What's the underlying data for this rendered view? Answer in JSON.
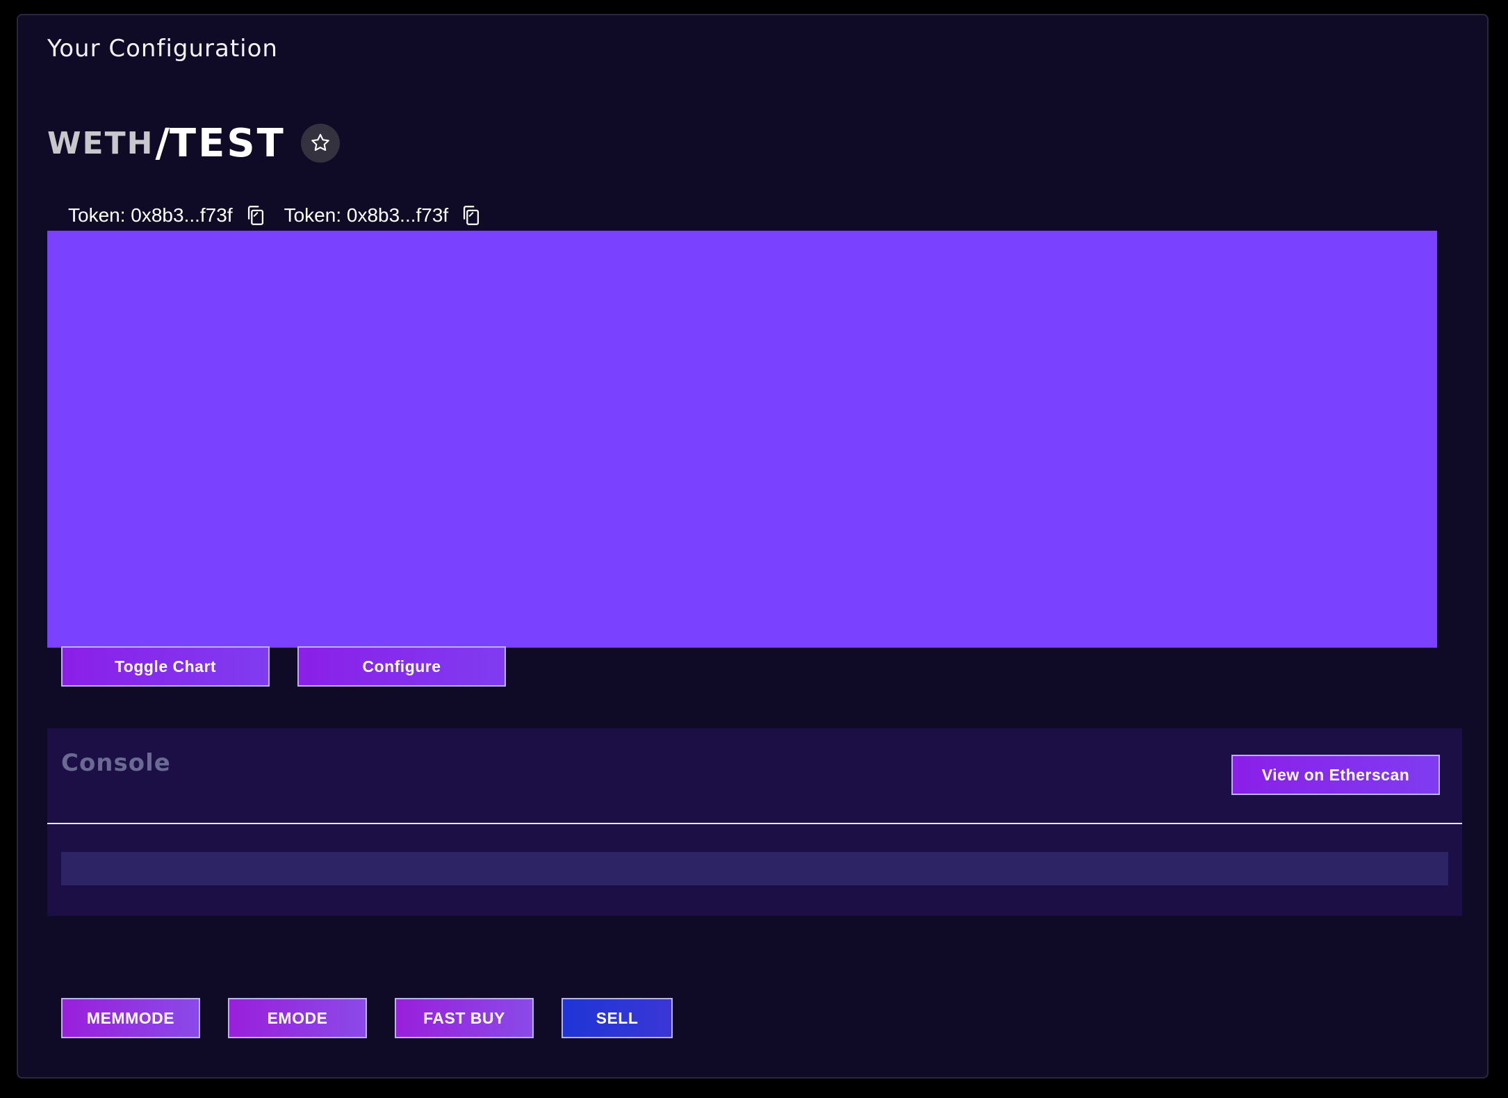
{
  "header": {
    "title": "Your Configuration"
  },
  "pair": {
    "base": "WETH",
    "separator": "/",
    "quote": "TEST"
  },
  "tokens": [
    {
      "label": "Token: 0x8b3...f73f"
    },
    {
      "label": "Token: 0x8b3...f73f"
    }
  ],
  "chart_panel": {
    "background_color": "#7a42ff"
  },
  "chart_controls": {
    "toggle_label": "Toggle Chart",
    "configure_label": "Configure"
  },
  "console": {
    "title": "Console",
    "etherscan_label": "View on Etherscan",
    "log_text": ""
  },
  "actions": {
    "memmode_label": "MEMMODE",
    "emode_label": "EMODE",
    "fast_buy_label": "FAST BUY",
    "sell_label": "SELL"
  },
  "colors": {
    "background": "#0f0b26",
    "accent_purple": "#8b1fe8",
    "sell_blue": "#1f35d6",
    "console_bg": "#1b0f45"
  },
  "icons": {
    "favorite": "star-icon",
    "copy": "copy-icon"
  }
}
